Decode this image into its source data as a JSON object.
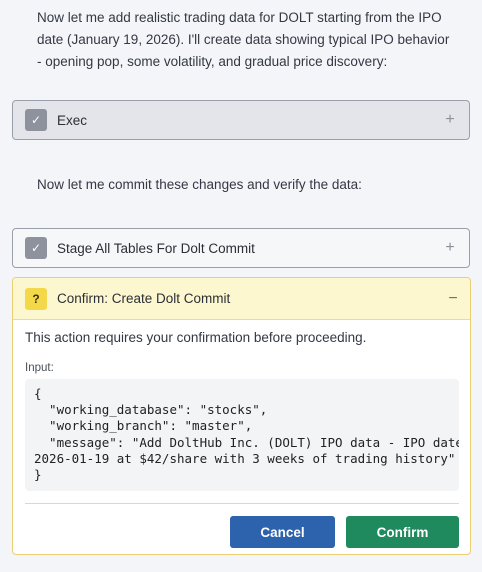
{
  "messages": {
    "intro": "Now let me add realistic trading data for DOLT starting from the IPO date (January 19, 2026). I'll create data showing typical IPO behavior - opening pop, some volatility, and gradual price discovery:",
    "commit_intro": "Now let me commit these changes and verify the data:"
  },
  "tools": {
    "exec": {
      "label": "Exec",
      "status_glyph": "✓",
      "expand_glyph": "+"
    },
    "stage": {
      "label": "Stage All Tables For Dolt Commit",
      "status_glyph": "✓",
      "expand_glyph": "+"
    }
  },
  "confirm_panel": {
    "title": "Confirm: Create Dolt Commit",
    "status_glyph": "?",
    "collapse_glyph": "−",
    "message": "This action requires your confirmation before proceeding.",
    "input_label": "Input:",
    "input_json": "{\n  \"working_database\": \"stocks\",\n  \"working_branch\": \"master\",\n  \"message\": \"Add DoltHub Inc. (DOLT) IPO data - IPO date\n2026-01-19 at $42/share with 3 weeks of trading history\"\n}",
    "cancel_label": "Cancel",
    "confirm_label": "Confirm"
  },
  "colors": {
    "page_bg": "#f4f5f8",
    "warning_bg": "#fdf7cf",
    "warning_border": "#e7cf72",
    "cancel": "#2d62ac",
    "confirm": "#1f8a5d"
  }
}
